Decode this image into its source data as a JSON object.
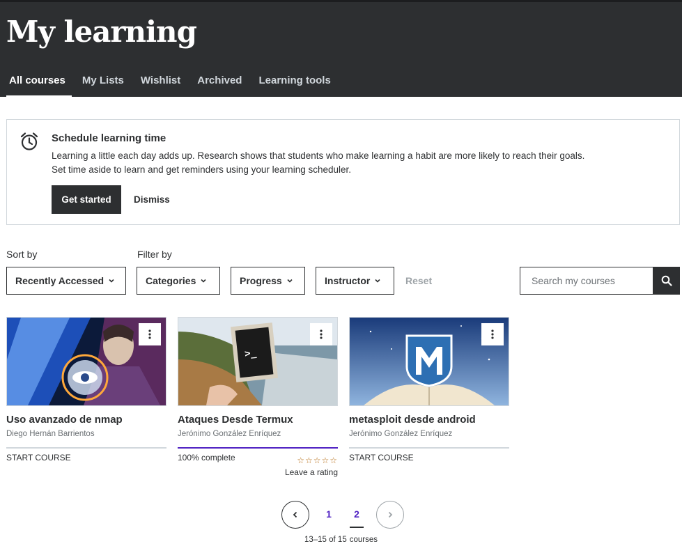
{
  "header": {
    "title": "My learning",
    "tabs": [
      {
        "label": "All courses",
        "active": true
      },
      {
        "label": "My Lists",
        "active": false
      },
      {
        "label": "Wishlist",
        "active": false
      },
      {
        "label": "Archived",
        "active": false
      },
      {
        "label": "Learning tools",
        "active": false
      }
    ]
  },
  "banner": {
    "icon": "alarm-clock-icon",
    "title": "Schedule learning time",
    "line1": "Learning a little each day adds up. Research shows that students who make learning a habit are more likely to reach their goals.",
    "line2": "Set time aside to learn and get reminders using your learning scheduler.",
    "primary_button": "Get started",
    "dismiss_button": "Dismiss"
  },
  "controls": {
    "sort_label": "Sort by",
    "filter_label": "Filter by",
    "sort_value": "Recently Accessed",
    "filters": [
      "Categories",
      "Progress",
      "Instructor"
    ],
    "reset": "Reset",
    "search_placeholder": "Search my courses"
  },
  "courses": [
    {
      "title": "Uso avanzado de nmap",
      "instructor": "Diego Hernán Barrientos",
      "status": "START COURSE",
      "progress": 0
    },
    {
      "title": "Ataques Desde Termux",
      "instructor": "Jerónimo González Enríquez",
      "status": "100% complete",
      "progress": 1.0,
      "stars": "☆☆☆☆☆",
      "rating_prompt": "Leave a rating"
    },
    {
      "title": "metasploit desde android",
      "instructor": "Jerónimo González Enríquez",
      "status": "START COURSE",
      "progress": 0
    }
  ],
  "pagination": {
    "pages": [
      "1",
      "2"
    ],
    "current_page": "2",
    "summary": "13–15 of 15",
    "summary_suffix": "courses"
  },
  "colors": {
    "header_bg": "#2d2f31",
    "accent_purple": "#5022c3",
    "star": "#b4690e"
  }
}
